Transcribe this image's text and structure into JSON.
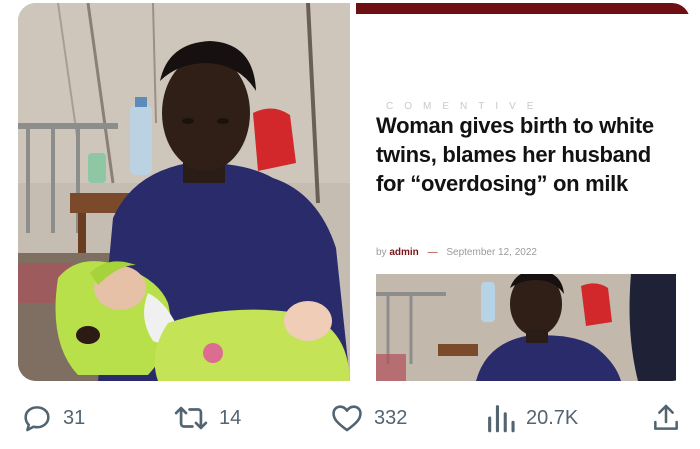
{
  "post": {
    "image_left": {
      "alt": "Mother holding newborn twins"
    },
    "article": {
      "site_watermark": "COMENTIVE",
      "headline": "Woman gives birth to white twins, blames her husband for “overdosing” on milk",
      "byline_prefix": "by",
      "author": "admin",
      "separator": "—",
      "date": "September 12, 2022"
    }
  },
  "actions": {
    "replies": {
      "icon": "reply-icon",
      "count": "31"
    },
    "reposts": {
      "icon": "repost-icon",
      "count": "14"
    },
    "likes": {
      "icon": "heart-icon",
      "count": "332"
    },
    "views": {
      "icon": "views-icon",
      "count": "20.7K"
    },
    "share": {
      "icon": "share-icon"
    }
  },
  "colors": {
    "action_gray": "#536471",
    "site_accent": "#6e0f14",
    "headline": "#121212"
  }
}
